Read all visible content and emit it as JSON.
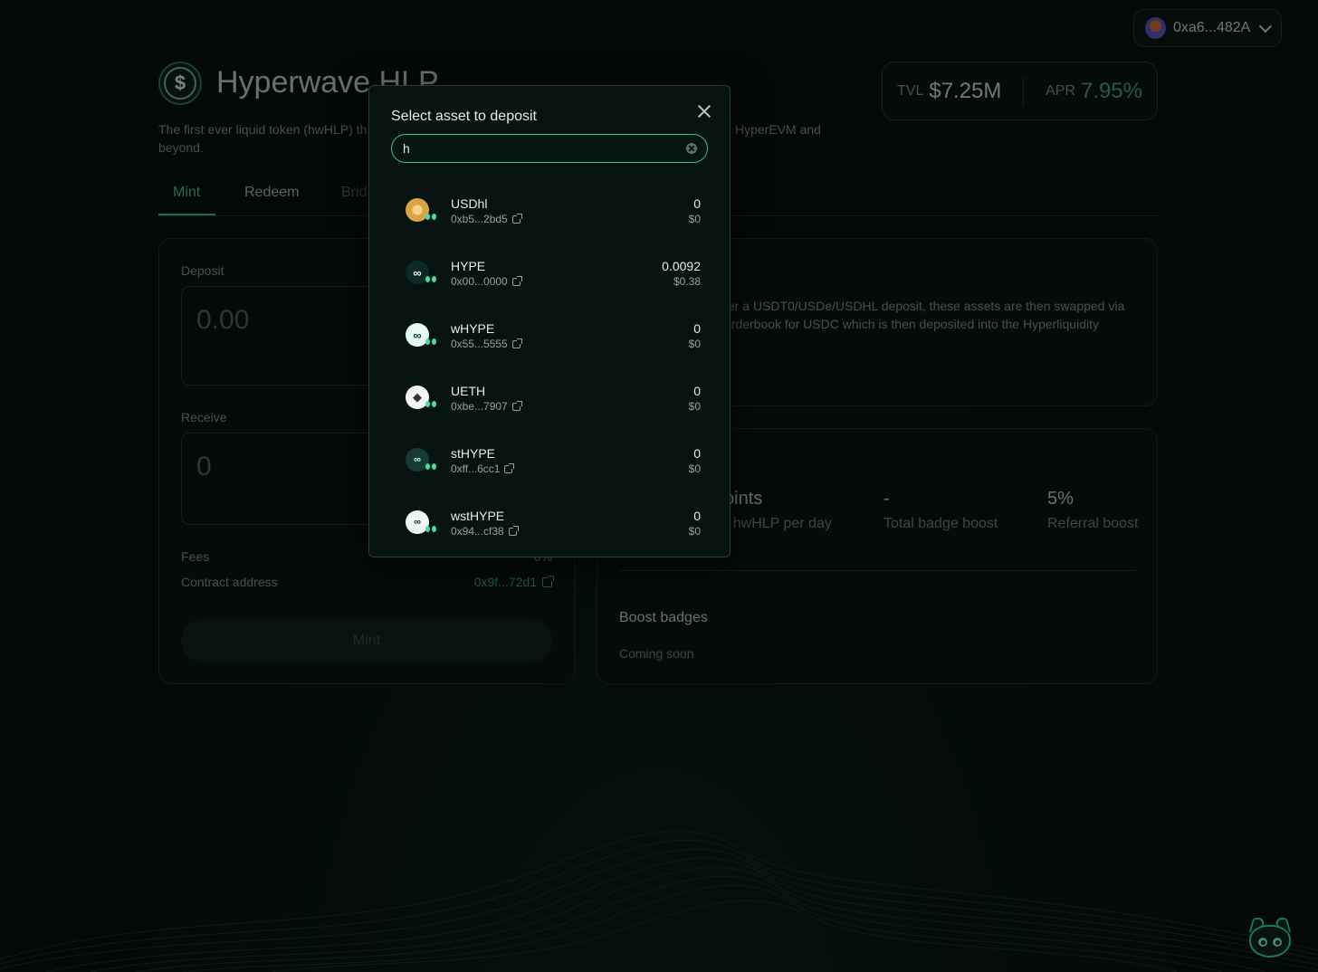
{
  "wallet": {
    "address": "0xa6...482A"
  },
  "header": {
    "title": "Hyperwave HLP",
    "subtitle_left": "The first ever liquid token (hwHLP) th",
    "subtitle_right": "HyperEVM and",
    "subtitle_line2": "beyond.",
    "logo_symbol": "$"
  },
  "stats": {
    "tvl_label": "TVL",
    "tvl_value": "$7.25M",
    "apr_label": "APR",
    "apr_value": "7.95%"
  },
  "tabs": [
    {
      "label": "Mint"
    },
    {
      "label": "Redeem"
    },
    {
      "label": "Brid"
    }
  ],
  "mint_card": {
    "deposit_label": "Deposit",
    "deposit_value": "0.00",
    "receive_label": "Receive",
    "receive_value": "0",
    "fees_label": "Fees",
    "fees_value": "0%",
    "contract_label": "Contract address",
    "contract_value": "0x9f...72d1",
    "mint_button": "Mint"
  },
  "info_card": {
    "line1": "ter a USDT0/USDe/USDHL deposit, these assets are then swapped via",
    "line2": "orderbook for USDC which is then deposited into the Hyperliquidity",
    "line3": ")."
  },
  "points_card": {
    "points_title": "oints",
    "points_sub": "r hwHLP per day",
    "badge_value": "-",
    "badge_label": "Total badge boost",
    "referral_value": "5%",
    "referral_label": "Referral boost",
    "boost_title": "Boost badges",
    "boost_sub": "Coming soon"
  },
  "modal": {
    "title": "Select asset to deposit",
    "search_value": "h",
    "assets": [
      {
        "name": "USDhl",
        "address": "0xb5...2bd5",
        "balance": "0",
        "usd": "$0"
      },
      {
        "name": "HYPE",
        "address": "0x00...0000",
        "balance": "0.0092",
        "usd": "$0.38"
      },
      {
        "name": "wHYPE",
        "address": "0x55...5555",
        "balance": "0",
        "usd": "$0"
      },
      {
        "name": "UETH",
        "address": "0xbe...7907",
        "balance": "0",
        "usd": "$0"
      },
      {
        "name": "stHYPE",
        "address": "0xff...6cc1",
        "balance": "0",
        "usd": "$0"
      },
      {
        "name": "wstHYPE",
        "address": "0x94...cf38",
        "balance": "0",
        "usd": "$0"
      }
    ]
  },
  "colors": {
    "accent": "#3fbf8f",
    "background": "#050b0a",
    "modal_bg": "#061311",
    "apr_green": "#3fa277"
  },
  "icons": {
    "asset_usdhl": "usdhl-coin-icon",
    "asset_hype": "hype-icon",
    "asset_ueth": "ethereum-icon",
    "mascot": "cat-mascot-icon"
  }
}
